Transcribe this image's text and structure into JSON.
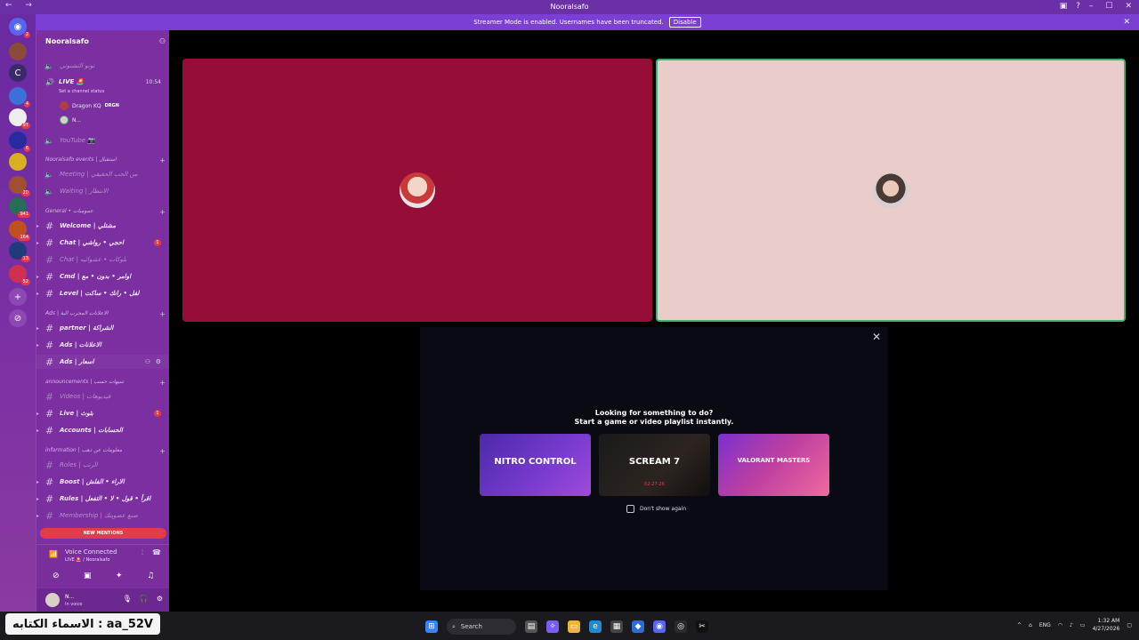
{
  "window": {
    "title": "Nooralsafo",
    "nav_arrows": "← →"
  },
  "banner": {
    "text": "Streamer Mode is enabled. Usernames have been truncated.",
    "disable_label": "Disable"
  },
  "server": {
    "name": "Nooralsafo"
  },
  "sidebar": {
    "top_partial_channel": "توتو التشنوتي",
    "live_channel": {
      "label": "LIVE 🚨",
      "timer": "10:54",
      "status": "Set a channel status"
    },
    "voice_users": [
      {
        "name": "Dragon KQ",
        "tag": "DRGN"
      },
      {
        "name": "N..."
      }
    ],
    "youtube_channel": "YouTube 📷",
    "categories": [
      {
        "label": "Nooralsafo events | استقبال"
      },
      {
        "label": "General • عمومیات"
      },
      {
        "label": "Ads | الاعلانات المجرب الية"
      },
      {
        "label": "announcements | تنبيهات حسب"
      },
      {
        "label": "information | معلومات عن ذهب"
      }
    ],
    "channels": [
      {
        "label": "Meeting | من الحب الحقيقي"
      },
      {
        "label": "Waiting | الانتظار"
      },
      {
        "label": "Welcome | مشتلي"
      },
      {
        "label": "Chat | احجي • رواشي",
        "badge": "1"
      },
      {
        "label": "Chat | بلوكات • عشوائيه"
      },
      {
        "label": "Cmd | اوامر • بدون • مع"
      },
      {
        "label": "Level | لفل • رانك • ساكت"
      },
      {
        "label": "partner | الشراكة"
      },
      {
        "label": "Ads | الاعلانات"
      },
      {
        "label": "Ads | اسعار"
      },
      {
        "label": "Videos | فيديوهات"
      },
      {
        "label": "Live | بثوث",
        "badge": "1"
      },
      {
        "label": "Accounts | الحسابات"
      },
      {
        "label": "Roles | الرتب"
      },
      {
        "label": "Boost | الاراء • الفلش"
      },
      {
        "label": "Rules | اقرأ • قول • لا • التفعل"
      },
      {
        "label": "Membership | صنع عضويتك"
      }
    ],
    "new_mentions": "NEW MENTIONS"
  },
  "voice_panel": {
    "title": "Voice Connected",
    "subtitle": "LIVE 🚨 / Nooralsafo"
  },
  "user_panel": {
    "name": "N...",
    "status": "In voice"
  },
  "server_rail": {
    "badges": [
      "2",
      "4",
      "97",
      "6",
      "20",
      "941",
      "164",
      "13",
      "52"
    ],
    "letter_server": "C"
  },
  "activity": {
    "title_line1": "Looking for something to do?",
    "title_line2": "Start a game or video playlist instantly.",
    "cards": [
      {
        "title": "NITRO CONTROL"
      },
      {
        "title": "SCREAM 7",
        "date": "02-27-26"
      },
      {
        "title": "VALORANT MASTERS"
      }
    ],
    "dont_show_label": "Don't show again"
  },
  "taskbar": {
    "search_label": "Search",
    "lang": "ENG",
    "time": "1:32 AM",
    "date": "4/27/2026"
  },
  "overlay": {
    "text": "الاسماء الكتابه : aa_52V"
  },
  "colors": {
    "accent": "#7b3fd4",
    "sidebar": "#7b2fa0",
    "tile_left": "#960d38",
    "tile_right": "#eacdca",
    "speaking_border": "#3bb36a",
    "badge": "#e23b4a"
  }
}
